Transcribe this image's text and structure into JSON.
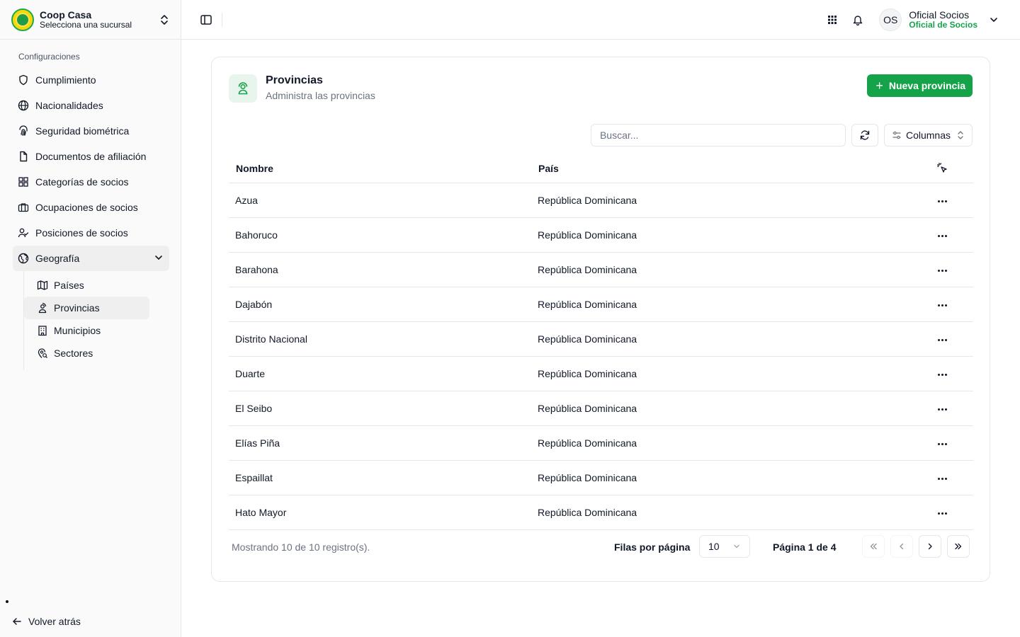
{
  "brand": {
    "title": "Coop Casa",
    "subtitle": "Selecciona una sucursal"
  },
  "sidebar": {
    "section_label": "Configuraciones",
    "items": [
      {
        "label": "Cumplimiento",
        "icon": "shield-icon"
      },
      {
        "label": "Nacionalidades",
        "icon": "globe-icon"
      },
      {
        "label": "Seguridad biométrica",
        "icon": "fingerprint-icon"
      },
      {
        "label": "Documentos de afiliación",
        "icon": "file-icon"
      },
      {
        "label": "Categorías de socios",
        "icon": "grid-icon"
      },
      {
        "label": "Ocupaciones de socios",
        "icon": "briefcase-icon"
      },
      {
        "label": "Posiciones de socios",
        "icon": "users-icon"
      }
    ],
    "group": {
      "label": "Geografía",
      "icon": "earth-icon",
      "children": [
        {
          "label": "Países",
          "icon": "map-icon"
        },
        {
          "label": "Provincias",
          "icon": "map-pin-user-icon",
          "active": true
        },
        {
          "label": "Municipios",
          "icon": "building-icon"
        },
        {
          "label": "Sectores",
          "icon": "map-pin-search-icon"
        }
      ]
    },
    "back_label": "Volver atrás"
  },
  "topbar": {
    "avatar_initials": "OS",
    "user_name": "Oficial Socios",
    "user_role": "Oficial de Socios"
  },
  "page": {
    "title": "Provincias",
    "subtitle": "Administra las provincias",
    "new_button": "Nueva provincia",
    "search_placeholder": "Buscar...",
    "columns_button": "Columnas"
  },
  "table": {
    "headers": {
      "name": "Nombre",
      "country": "País"
    },
    "rows": [
      {
        "name": "Azua",
        "country": "República Dominicana"
      },
      {
        "name": "Bahoruco",
        "country": "República Dominicana"
      },
      {
        "name": "Barahona",
        "country": "República Dominicana"
      },
      {
        "name": "Dajabón",
        "country": "República Dominicana"
      },
      {
        "name": "Distrito Nacional",
        "country": "República Dominicana"
      },
      {
        "name": "Duarte",
        "country": "República Dominicana"
      },
      {
        "name": "El Seibo",
        "country": "República Dominicana"
      },
      {
        "name": "Elías Piña",
        "country": "República Dominicana"
      },
      {
        "name": "Espaillat",
        "country": "República Dominicana"
      },
      {
        "name": "Hato Mayor",
        "country": "República Dominicana"
      }
    ]
  },
  "footer": {
    "showing": "Mostrando 10 de 10 registro(s).",
    "rows_per_page_label": "Filas por página",
    "rows_per_page_value": "10",
    "page_info": "Página 1 de 4"
  },
  "colors": {
    "accent": "#15a34a",
    "role": "#16a34a",
    "border": "#e5e7eb"
  }
}
